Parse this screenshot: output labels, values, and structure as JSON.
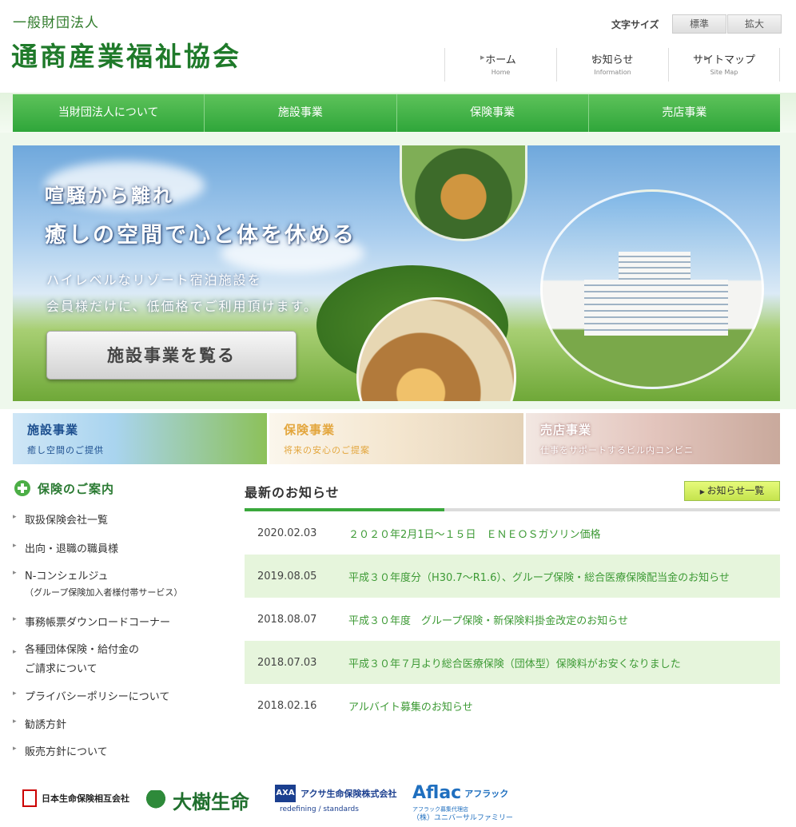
{
  "header": {
    "org_type": "一般財団法人",
    "org_name": "通商産業福祉協会",
    "font_size": {
      "label": "文字サイズ",
      "standard": "標準",
      "large": "拡大"
    },
    "util_nav": [
      {
        "label": "ホーム",
        "sub": "Home"
      },
      {
        "label": "お知らせ",
        "sub": "Information"
      },
      {
        "label": "サイトマップ",
        "sub": "Site Map"
      }
    ]
  },
  "gnav": [
    "当財団法人について",
    "施設事業",
    "保険事業",
    "売店事業"
  ],
  "hero": {
    "heading1": "喧騒から離れ",
    "heading2": "癒しの空間で心と体を休める",
    "text1": "ハイレベルなリゾート宿泊施設を",
    "text2": "会員様だけに、低価格でご利用頂けます。",
    "button": "施設事業を覧る"
  },
  "banners": [
    {
      "title": "施設事業",
      "sub": "癒し空間のご提供"
    },
    {
      "title": "保険事業",
      "sub": "将来の安心のご提案"
    },
    {
      "title": "売店事業",
      "sub": "仕事をサポートするビル内コンビニ"
    }
  ],
  "side": {
    "title": "保険のご案内",
    "items": [
      {
        "label": "取扱保険会社一覧"
      },
      {
        "label": "出向・退職の職員様"
      },
      {
        "label": "N-コンシェルジュ",
        "sub": "（グループ保険加入者様付帯サービス）"
      },
      {
        "label": "事務帳票ダウンロードコーナー"
      },
      {
        "label": "各種団体保険・給付金の",
        "label2": "ご請求について"
      },
      {
        "label": "プライバシーポリシーについて"
      },
      {
        "label": "勧誘方針"
      },
      {
        "label": "販売方針について"
      }
    ]
  },
  "news": {
    "title": "最新のお知らせ",
    "more": "お知らせ一覧",
    "items": [
      {
        "date": "2020.02.03",
        "title": "２０２０年2月1日～１５日　ＥＮＥＯＳガソリン価格"
      },
      {
        "date": "2019.08.05",
        "title": "平成３０年度分（H30.7～R1.6）、グループ保険・総合医療保険配当金のお知らせ"
      },
      {
        "date": "2018.08.07",
        "title": "平成３０年度　グループ保険・新保険料掛金改定のお知らせ"
      },
      {
        "date": "2018.07.03",
        "title": "平成３０年７月より総合医療保険（団体型）保険料がお安くなりました"
      },
      {
        "date": "2018.02.16",
        "title": "アルバイト募集のお知らせ"
      }
    ]
  },
  "partners": {
    "nissay": {
      "mark": "NISSAY",
      "name": "日本生命保険相互会社"
    },
    "taiju": {
      "name": "大樹生命"
    },
    "axa": {
      "mark": "AXA",
      "name": "アクサ生命保険株式会社",
      "tag": "redefining / standards"
    },
    "aflac": {
      "name": "Aflac",
      "ja": "アフラック",
      "sub1": "アフラック募集代理店",
      "sub2": "（株）ユニバーサルファミリー"
    }
  },
  "colors": {
    "brand_green": "#2fa63a",
    "news_text": "#3d9a35",
    "shade": "#e6f5dc"
  }
}
